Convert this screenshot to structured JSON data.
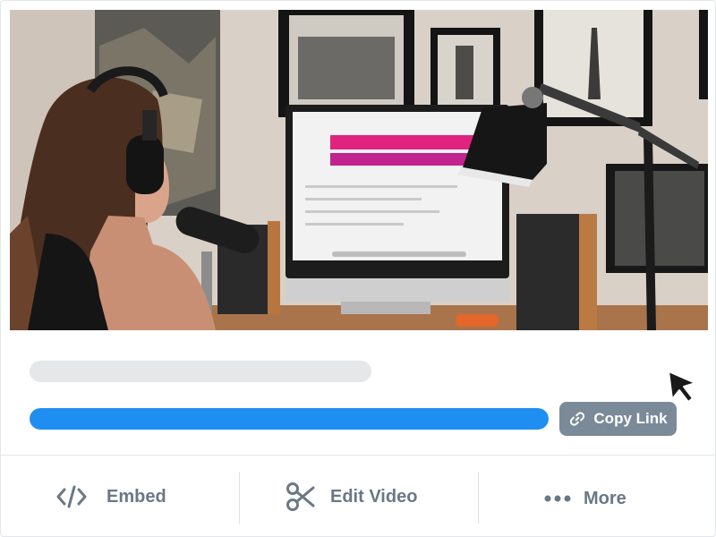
{
  "video": {
    "thumbnail_icon": "video-thumbnail",
    "progress_percent": 100
  },
  "toolbar": {
    "copy_link_label": "Copy Link",
    "copy_link_icon": "link-icon"
  },
  "actions": {
    "embed_label": "Embed",
    "embed_icon": "code-icon",
    "edit_label": "Edit Video",
    "edit_icon": "scissors-icon",
    "more_label": "More",
    "more_icon": "ellipsis-icon"
  },
  "colors": {
    "progress": "#1f8ef1",
    "button": "#7b8a98",
    "action_text": "#6a7886"
  }
}
